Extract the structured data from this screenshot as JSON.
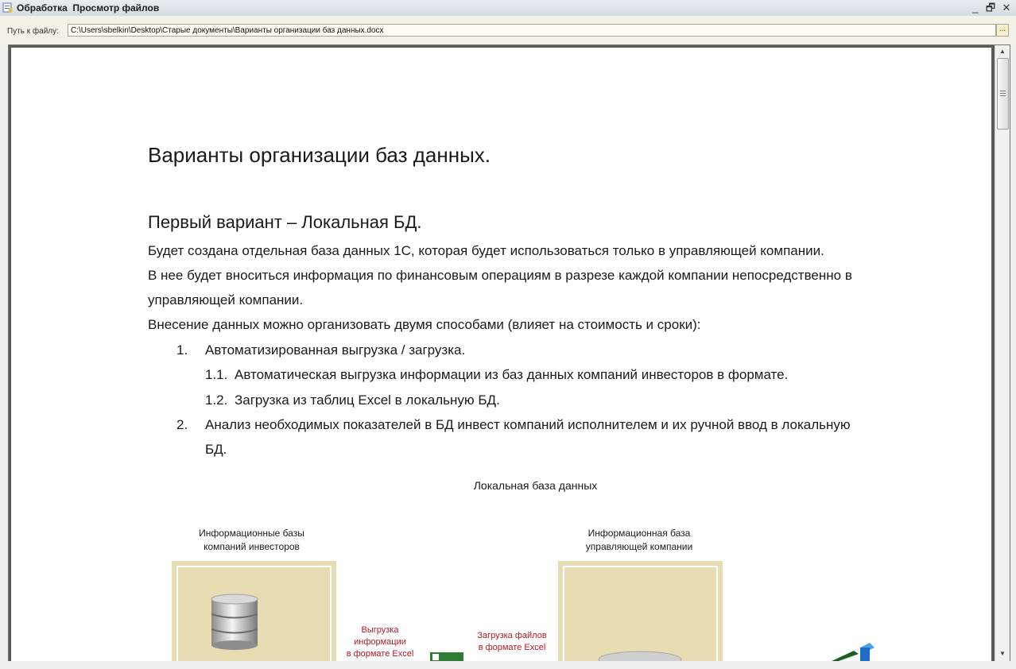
{
  "window": {
    "title": "Обработка  Просмотр файлов",
    "controls": {
      "minimize": "_",
      "restore": "🗗",
      "close": "✕"
    }
  },
  "path_field": {
    "label": "Путь к файлу:",
    "value": "C:\\Users\\sbelkin\\Desktop\\Старые документы\\Варианты организации баз данных.docx",
    "browse_label": "..."
  },
  "document": {
    "title": "Варианты организации баз данных.",
    "section_heading": "Первый вариант – Локальная БД.",
    "paragraphs": [
      "Будет создана отдельная база данных 1С, которая будет использоваться только в управляющей компании.",
      "В нее будет вноситься информация по финансовым операциям в разрезе каждой компании непосредственно в",
      "управляющей компании.",
      "Внесение данных можно организовать двумя способами (влияет на стоимость и сроки):"
    ],
    "list": [
      {
        "num": "1.",
        "text": "Автоматизированная выгрузка / загрузка."
      },
      {
        "num": "1.1.",
        "text": "Автоматическая выгрузка информации из баз данных компаний инвесторов в формате."
      },
      {
        "num": "1.2.",
        "text": "Загрузка из таблиц Excel в локальную БД."
      },
      {
        "num": "2.",
        "text": "Анализ необходимых показателей в БД инвест компаний исполнителем и их ручной ввод в локальную",
        "cont": "БД."
      }
    ],
    "diagram": {
      "caption": "Локальная база данных",
      "left_label": [
        "Информационные базы",
        "компаний инвесторов"
      ],
      "right_label": [
        "Информационная база",
        "управляющей компании"
      ],
      "arrow1_label": [
        "Выгрузка",
        "информации",
        "в формате Excel"
      ],
      "arrow2_label": [
        "Загрузка файлов",
        "в формате Excel"
      ]
    }
  },
  "colors": {
    "panel": "#e8ddb2",
    "red_text": "#b0192a"
  },
  "icons": [
    "app-icon",
    "database-icon",
    "excel-icon",
    "cube-icon"
  ]
}
